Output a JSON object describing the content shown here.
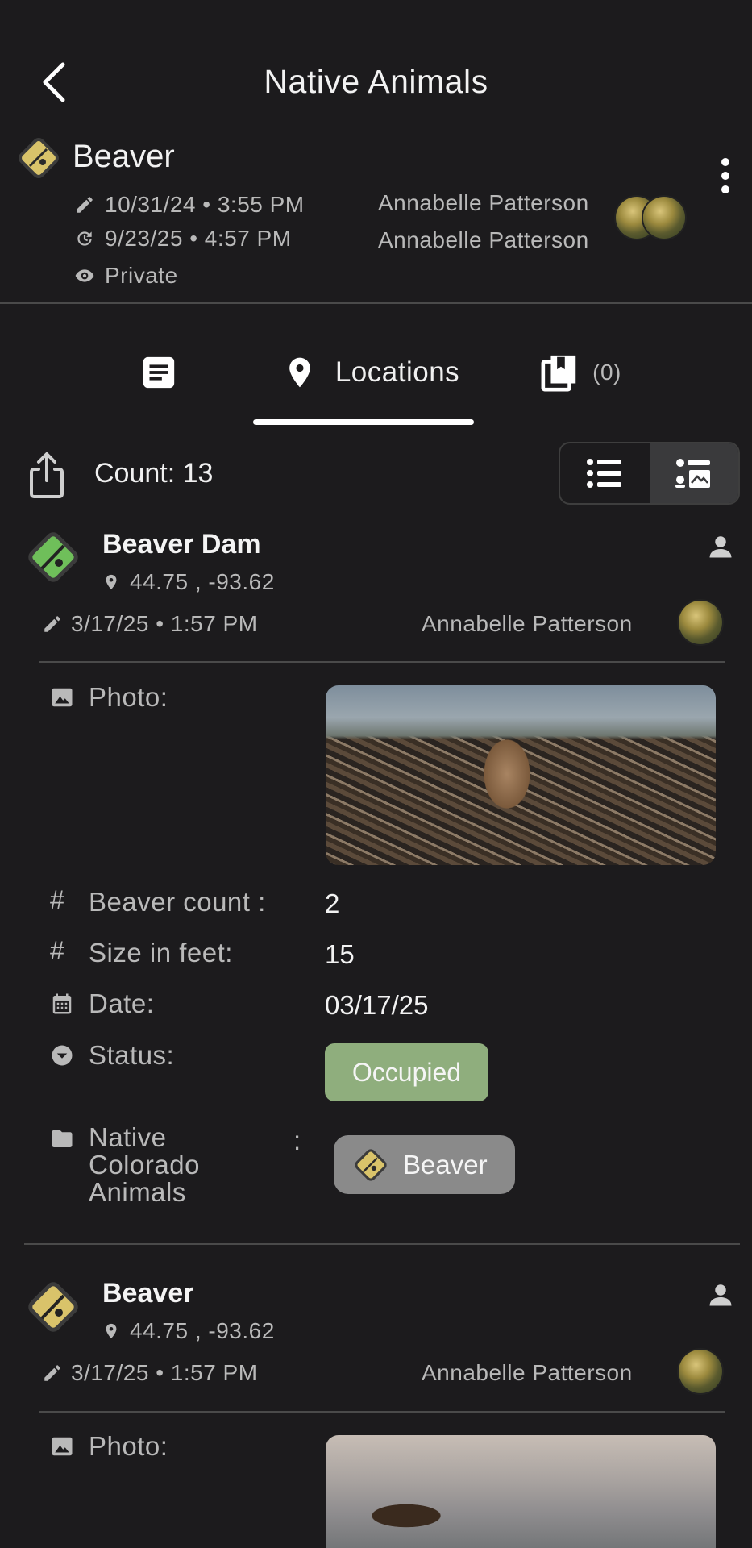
{
  "header": {
    "title": "Native Animals"
  },
  "record": {
    "name": "Beaver",
    "created": "10/31/24 • 3:55 PM",
    "updated": "9/23/25 • 4:57 PM",
    "visibility": "Private",
    "created_by": "Annabelle Patterson",
    "updated_by": "Annabelle Patterson"
  },
  "tabs": [
    {
      "label": "",
      "icon": "notes-icon"
    },
    {
      "label": "Locations",
      "icon": "location-pin-icon"
    },
    {
      "label": "(0)",
      "icon": "collections-icon"
    }
  ],
  "toolbar": {
    "count": "Count: 13"
  },
  "locations": [
    {
      "title": "Beaver Dam",
      "coords": "44.75 , -93.62",
      "edited": "3/17/25 • 1:57 PM",
      "author": "Annabelle Patterson",
      "badge_color": "#6fbf5a",
      "fields": {
        "photo_label": "Photo:",
        "count_label": "Beaver count :",
        "count_value": "2",
        "size_label": "Size in feet:",
        "size_value": "15",
        "date_label": "Date:",
        "date_value": "03/17/25",
        "status_label": "Status:",
        "status_value": "Occupied",
        "group_label_1": "Native",
        "group_label_2": "Colorado",
        "group_label_3": "Animals",
        "group_colon": ":",
        "group_value": "Beaver"
      }
    },
    {
      "title": "Beaver",
      "coords": "44.75 , -93.62",
      "edited": "3/17/25 • 1:57 PM",
      "author": "Annabelle Patterson",
      "badge_color": "#d9c36a",
      "fields": {
        "photo_label": "Photo:"
      }
    }
  ],
  "colors": {
    "background": "#1c1b1d",
    "status_occupied": "#8fae7d",
    "chip_gray": "#8a8a8a",
    "beaver_badge": "#d9c36a"
  }
}
